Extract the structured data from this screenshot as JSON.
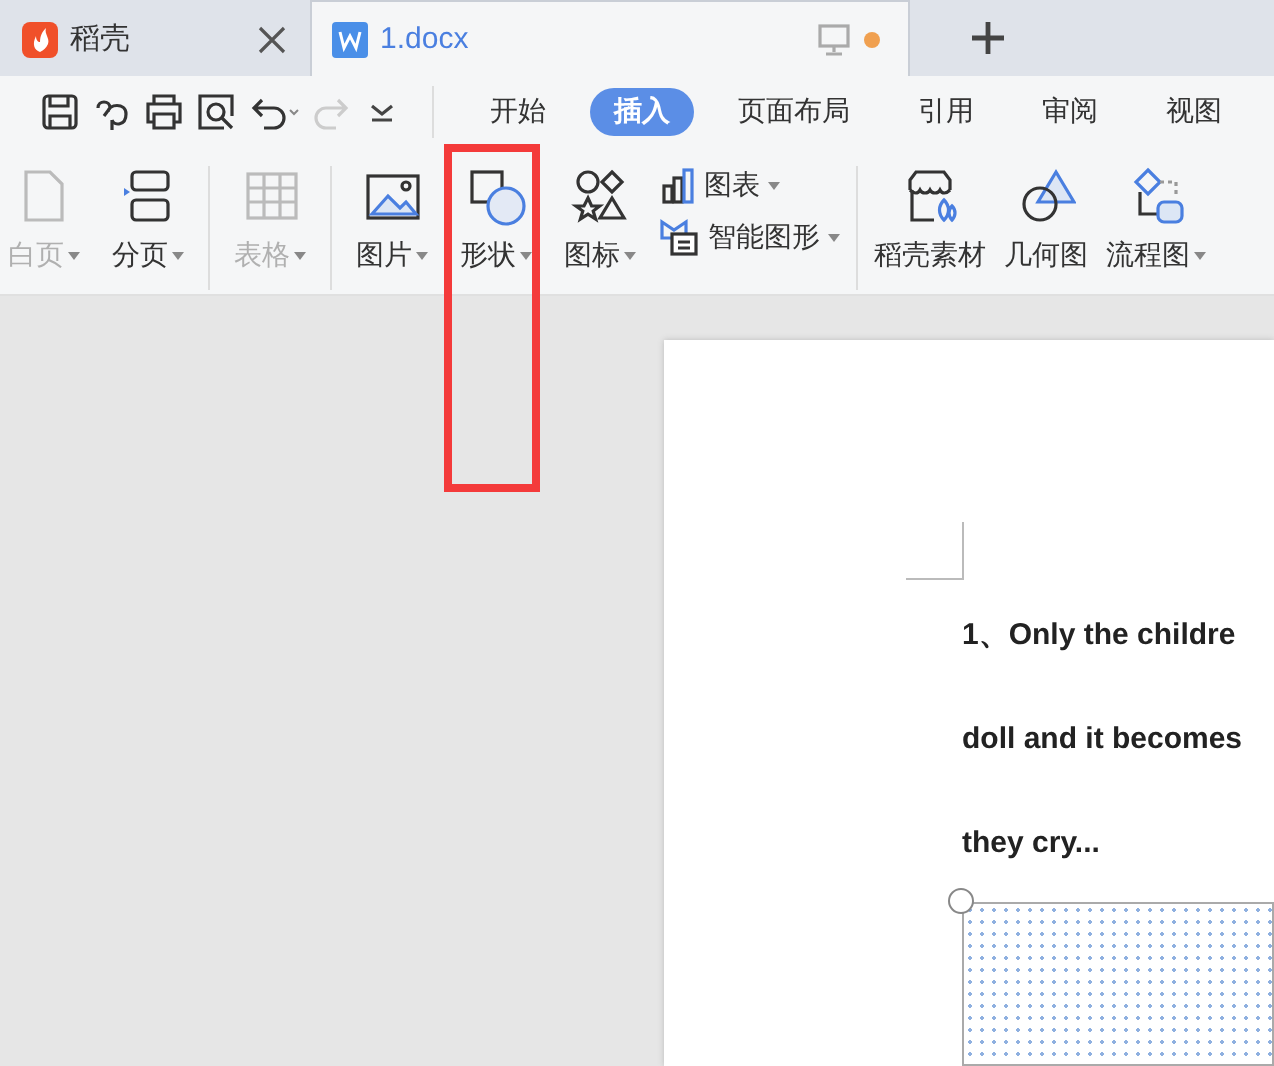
{
  "tabs": [
    {
      "kind": "home",
      "title": "稻壳",
      "selected": false,
      "closable": true,
      "modified": false
    },
    {
      "kind": "document",
      "title": "1.docx",
      "selected": true,
      "closable": false,
      "modified": true
    }
  ],
  "menu": [
    {
      "label": "开始",
      "selected": false
    },
    {
      "label": "插入",
      "selected": true
    },
    {
      "label": "页面布局",
      "selected": false
    },
    {
      "label": "引用",
      "selected": false
    },
    {
      "label": "审阅",
      "selected": false
    },
    {
      "label": "视图",
      "selected": false
    }
  ],
  "ribbon": [
    {
      "items": [
        {
          "kind": "large",
          "label": "白页",
          "disabled": true,
          "dropdown": true
        },
        {
          "kind": "large",
          "label": "分页",
          "disabled": false,
          "dropdown": true
        }
      ]
    },
    {
      "items": [
        {
          "kind": "large",
          "label": "表格",
          "disabled": true,
          "dropdown": true
        }
      ]
    },
    {
      "items": [
        {
          "kind": "large",
          "label": "图片",
          "disabled": false,
          "dropdown": true
        },
        {
          "kind": "large",
          "label": "形状",
          "disabled": false,
          "dropdown": true
        },
        {
          "kind": "large",
          "label": "图标",
          "disabled": false,
          "dropdown": true
        },
        {
          "kind": "stack",
          "items": [
            {
              "label": "图表",
              "dropdown": true
            },
            {
              "label": "智能图形",
              "dropdown": true
            }
          ]
        }
      ]
    },
    {
      "items": [
        {
          "kind": "large",
          "label": "稻壳素材",
          "disabled": false,
          "dropdown": false
        },
        {
          "kind": "large",
          "label": "几何图",
          "disabled": false,
          "dropdown": false
        },
        {
          "kind": "large",
          "label": "流程图",
          "disabled": false,
          "dropdown": true
        }
      ]
    }
  ],
  "document": {
    "lines": [
      "1、Only the childre",
      "doll and it becomes",
      "they cry..."
    ]
  }
}
